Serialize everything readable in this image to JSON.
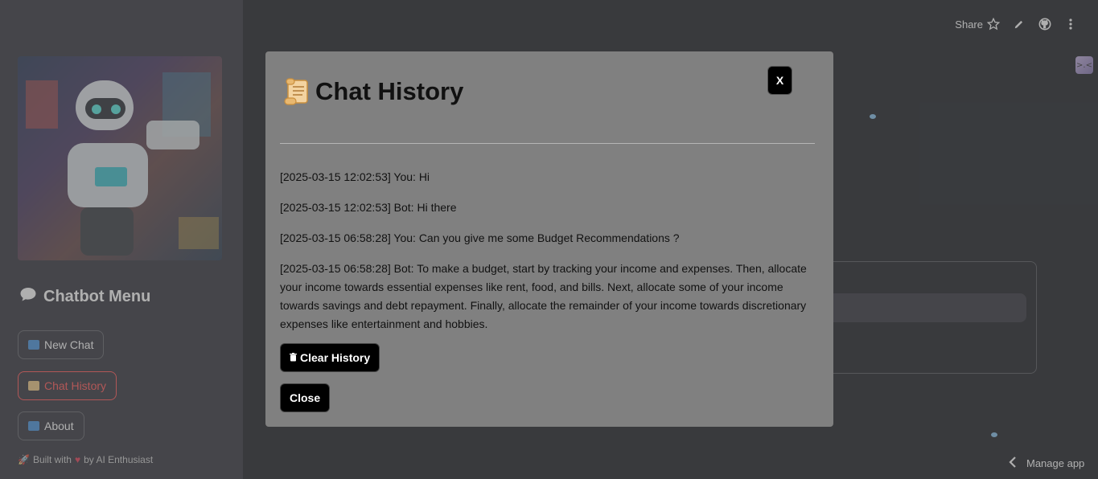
{
  "sidebar": {
    "title": "Chatbot Menu",
    "buttons": [
      {
        "label": "New Chat",
        "icon": "new-chat-icon"
      },
      {
        "label": "Chat History",
        "icon": "scroll-icon"
      },
      {
        "label": "About",
        "icon": "info-icon"
      }
    ],
    "footer": {
      "prefix": "Built with",
      "suffix": "by AI Enthusiast"
    }
  },
  "toolbar": {
    "share_label": "Share",
    "icons": [
      "star-icon",
      "edit-icon",
      "github-icon",
      "more-vert-icon"
    ]
  },
  "manage_app": {
    "label": "Manage app"
  },
  "modal": {
    "title": "Chat History",
    "close_label": "X",
    "messages": [
      "[2025-03-15 12:02:53] You: Hi",
      "[2025-03-15 12:02:53] Bot: Hi there",
      "[2025-03-15 06:58:28] You: Can you give me some Budget Recommendations ?",
      "[2025-03-15 06:58:28] Bot: To make a budget, start by tracking your income and expenses. Then, allocate your income towards essential expenses like rent, food, and bills. Next, allocate some of your income towards savings and debt repayment. Finally, allocate the remainder of your income towards discretionary expenses like entertainment and hobbies."
    ],
    "clear_label": "Clear History",
    "close_button_label": "Close"
  },
  "colors": {
    "page_bg": "#0e1117",
    "sidebar_bg": "#262730",
    "accent_red": "#ff4b4b",
    "modal_bg": "#808080",
    "button_black": "#000000"
  }
}
